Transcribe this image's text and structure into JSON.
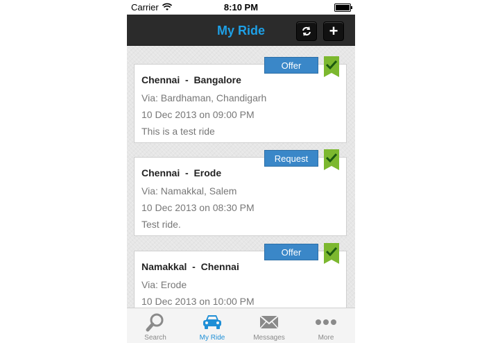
{
  "status_bar": {
    "carrier": "Carrier",
    "time": "8:10 PM"
  },
  "nav": {
    "title": "My Ride",
    "title_color": "#1ea0e6",
    "refresh_icon": "refresh-icon",
    "add_label": "+"
  },
  "rides": [
    {
      "from": "Chennai",
      "to": "Bangalore",
      "route": "Chennai  -  Bangalore",
      "type": "Offer",
      "via": "Via: Bardhaman, Chandigarh",
      "when": "10 Dec 2013 on 09:00 PM",
      "note": "This is a test ride"
    },
    {
      "from": "Chennai",
      "to": "Erode",
      "route": "Chennai  -  Erode",
      "type": "Request",
      "via": "Via: Namakkal, Salem",
      "when": "10 Dec 2013 on 08:30 PM",
      "note": "Test ride."
    },
    {
      "from": "Namakkal",
      "to": "Chennai",
      "route": "Namakkal  -  Chennai",
      "type": "Offer",
      "via": "Via: Erode",
      "when": "10 Dec 2013 on 10:00 PM",
      "note": ""
    }
  ],
  "tabs": [
    {
      "label": "Search",
      "icon": "search-icon"
    },
    {
      "label": "My Ride",
      "icon": "car-icon",
      "active": true
    },
    {
      "label": "Messages",
      "icon": "envelope-icon"
    },
    {
      "label": "More",
      "icon": "more-dots-icon"
    }
  ],
  "colors": {
    "badge": "#3a87c8",
    "ribbon": "#7cb82f",
    "active_tab": "#1f8fd6",
    "nav_bg": "#2b2b2b"
  }
}
